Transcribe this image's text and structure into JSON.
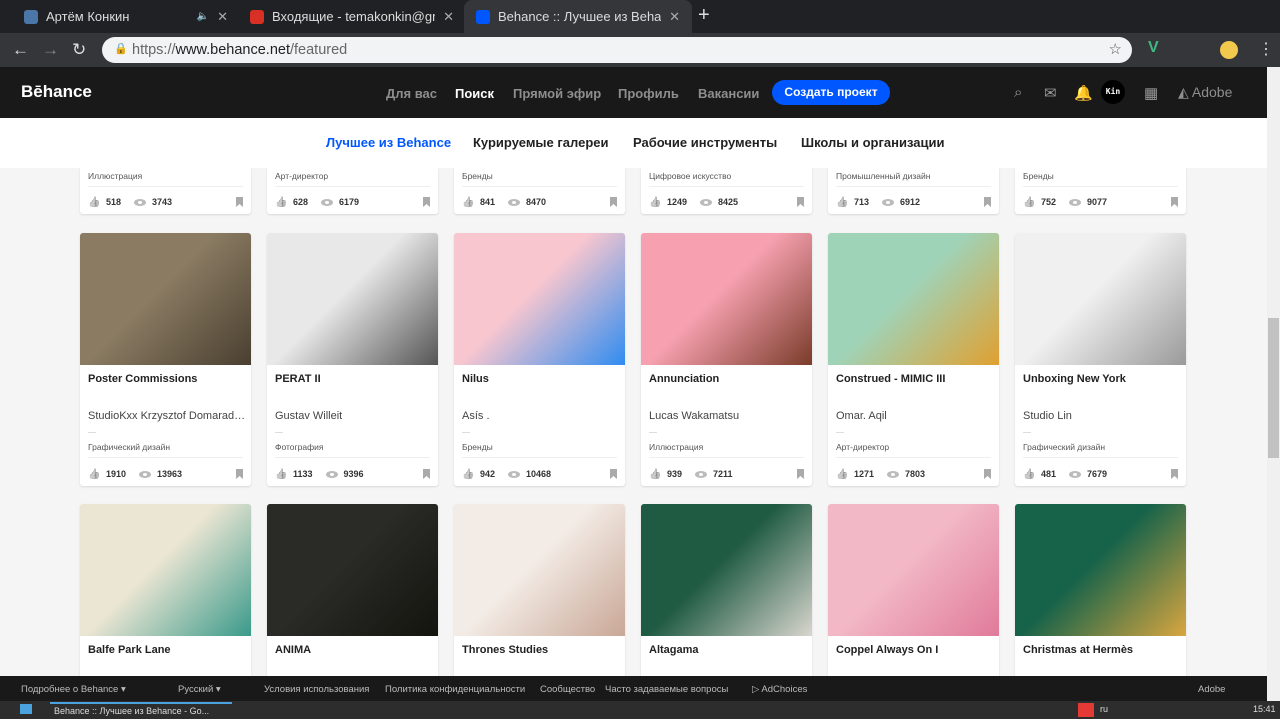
{
  "browser": {
    "tabs": [
      {
        "title": "Артём Конкин",
        "favicon_color": "#4a76a8",
        "active": false
      },
      {
        "title": "Входящие - temakonkin@gmail.com",
        "favicon_color": "#d93025",
        "active": false
      },
      {
        "title": "Behance :: Лучшее из Behance",
        "favicon_color": "#0057ff",
        "active": true
      }
    ],
    "url_scheme": "https://",
    "url_host": "www.behance.net",
    "url_path": "/featured"
  },
  "header": {
    "logo": "Bēhance",
    "nav": [
      "Для вас",
      "Поиск",
      "Прямой эфир",
      "Профиль",
      "Вакансии"
    ],
    "active_nav": "Поиск",
    "create_button": "Создать проект",
    "avatar_text": "Kin",
    "adobe": "Adobe"
  },
  "subnav": {
    "items": [
      "Лучшее из Behance",
      "Курируемые галереи",
      "Рабочие инструменты",
      "Школы и организации"
    ],
    "active": "Лучшее из Behance"
  },
  "projects_row1": [
    {
      "category": "Иллюстрация",
      "likes": "518",
      "views": "3743"
    },
    {
      "category": "Арт-директор",
      "likes": "628",
      "views": "6179"
    },
    {
      "category": "Бренды",
      "likes": "841",
      "views": "8470"
    },
    {
      "category": "Цифровое искусство",
      "likes": "1249",
      "views": "8425"
    },
    {
      "category": "Промышленный дизайн",
      "likes": "713",
      "views": "6912"
    },
    {
      "category": "Бренды",
      "likes": "752",
      "views": "9077"
    }
  ],
  "projects_row2": [
    {
      "title": "Poster Commissions",
      "author": "StudioKxx Krzysztof Domaradzki",
      "category": "Графический дизайн",
      "likes": "1910",
      "views": "13963",
      "colors": [
        "#8a7b62",
        "#4a3f30"
      ]
    },
    {
      "title": "PERAT II",
      "author": "Gustav Willeit",
      "category": "Фотография",
      "likes": "1133",
      "views": "9396",
      "colors": [
        "#e8e8e8",
        "#555"
      ]
    },
    {
      "title": "Nilus",
      "author": "Asís .",
      "category": "Бренды",
      "likes": "942",
      "views": "10468",
      "colors": [
        "#f7c6cf",
        "#2f8cf0"
      ]
    },
    {
      "title": "Annunciation",
      "author": "Lucas Wakamatsu",
      "category": "Иллюстрация",
      "likes": "939",
      "views": "7211",
      "colors": [
        "#f7a1b0",
        "#7a3c2a"
      ]
    },
    {
      "title": "Construed - MIMIC III",
      "author": "Omar. Aqil",
      "category": "Арт-директор",
      "likes": "1271",
      "views": "7803",
      "colors": [
        "#9fd3b8",
        "#e0a030"
      ]
    },
    {
      "title": "Unboxing New York",
      "author": "Studio Lin",
      "category": "Графический дизайн",
      "likes": "481",
      "views": "7679",
      "colors": [
        "#f0f0f0",
        "#9a9a9a"
      ]
    }
  ],
  "projects_row3": [
    {
      "title": "Balfe Park Lane",
      "colors": [
        "#ebe5d3",
        "#3a9a8a"
      ]
    },
    {
      "title": "ANIMA",
      "colors": [
        "#2a2a26",
        "#14140f"
      ]
    },
    {
      "title": "Thrones Studies",
      "colors": [
        "#f3ece6",
        "#c9a796"
      ]
    },
    {
      "title": "Altagama",
      "colors": [
        "#1f5a42",
        "#d9d6cf"
      ]
    },
    {
      "title": "Coppel Always On I",
      "colors": [
        "#f2b8c6",
        "#e07a9a"
      ]
    },
    {
      "title": "Christmas at Hermès",
      "colors": [
        "#17634a",
        "#d9a640"
      ]
    }
  ],
  "footer": {
    "links": [
      "Подробнее о Behance ▾",
      "Русский ▾",
      "Условия использования",
      "Политика конфиденциальности",
      "Сообщество",
      "Часто задаваемые вопросы",
      "▷ AdChoices"
    ],
    "adobe": "Adobe"
  },
  "taskbar": {
    "window": "Behance :: Лучшее из Behance - Go...",
    "lang": "ru",
    "time": "15:41"
  }
}
